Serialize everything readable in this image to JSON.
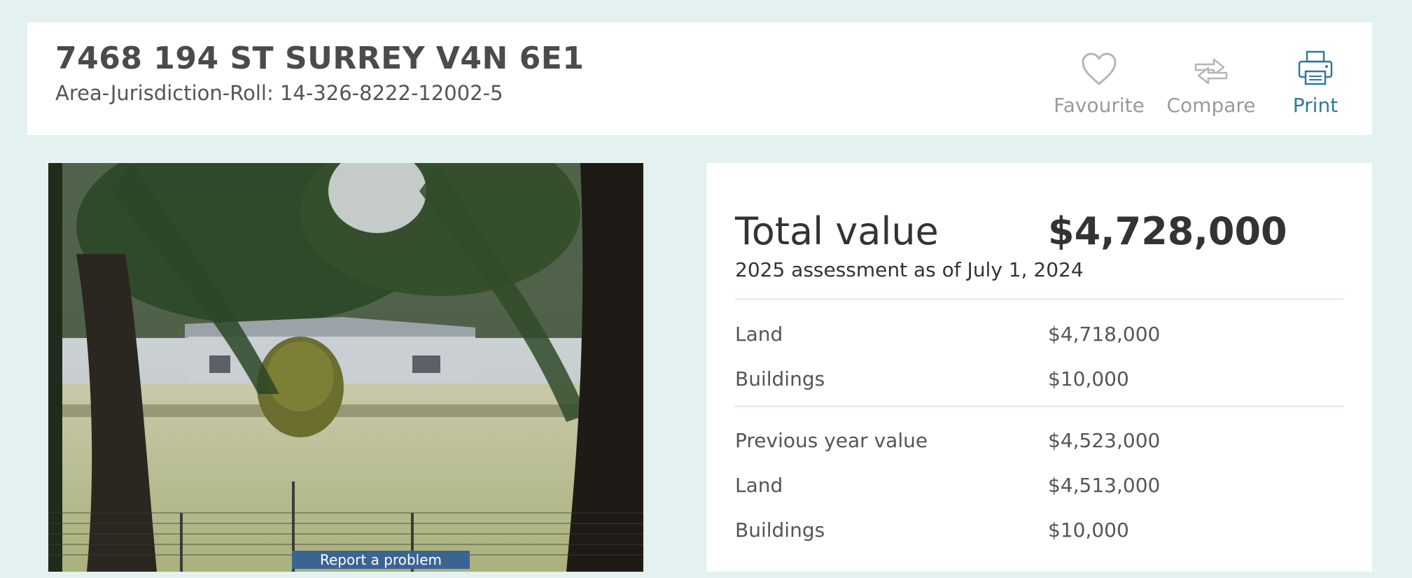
{
  "header": {
    "address": "7468 194 ST SURREY V4N 6E1",
    "roll": "Area-Jurisdiction-Roll: 14-326-8222-12002-5",
    "actions": [
      {
        "label": "Favourite",
        "icon": "heart-icon"
      },
      {
        "label": "Compare",
        "icon": "compare-arrows-icon"
      },
      {
        "label": "Print",
        "icon": "printer-icon"
      }
    ]
  },
  "photo": {
    "report_label": "Report a problem"
  },
  "values": {
    "total_label": "Total value",
    "total_value": "$4,728,000",
    "as_of": "2025 assessment as of July 1, 2024",
    "current": [
      {
        "label": "Land",
        "value": "$4,718,000"
      },
      {
        "label": "Buildings",
        "value": "$10,000"
      }
    ],
    "previous_label": "Previous year value",
    "previous_value": "$4,523,000",
    "previous": [
      {
        "label": "Land",
        "value": "$4,513,000"
      },
      {
        "label": "Buildings",
        "value": "$10,000"
      }
    ]
  },
  "colors": {
    "page_bg": "#e3f1f1",
    "accent": "#2f7a98",
    "muted_icon": "#b5b5b5",
    "report_bg": "#3c6493"
  }
}
